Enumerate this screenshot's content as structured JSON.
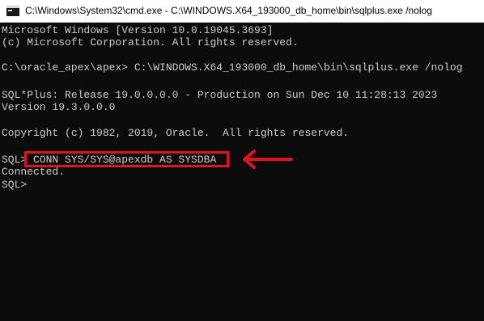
{
  "window": {
    "title": "C:\\Windows\\System32\\cmd.exe - C:\\WINDOWS.X64_193000_db_home\\bin\\sqlplus.exe  /nolog",
    "app_icon": "cmd-console-icon"
  },
  "console": {
    "lines": [
      "Microsoft Windows [Version 10.0.19045.3693]",
      "(c) Microsoft Corporation. All rights reserved.",
      "",
      "C:\\oracle_apex\\apex> C:\\WINDOWS.X64_193000_db_home\\bin\\sqlplus.exe /nolog",
      "",
      "SQL*Plus: Release 19.0.0.0.0 - Production on Sun Dec 10 11:28:13 2023",
      "Version 19.3.0.0.0",
      "",
      "Copyright (c) 1982, 2019, Oracle.  All rights reserved.",
      "",
      "SQL> CONN SYS/SYS@apexdb AS SYSDBA",
      "Connected.",
      "SQL>"
    ]
  },
  "annotation": {
    "highlight_color": "#e0141e",
    "arrow_icon": "left-arrow-icon"
  },
  "colors": {
    "console_bg": "#0c0c0c",
    "console_fg": "#cccccc",
    "titlebar_bg": "#ffffff"
  }
}
